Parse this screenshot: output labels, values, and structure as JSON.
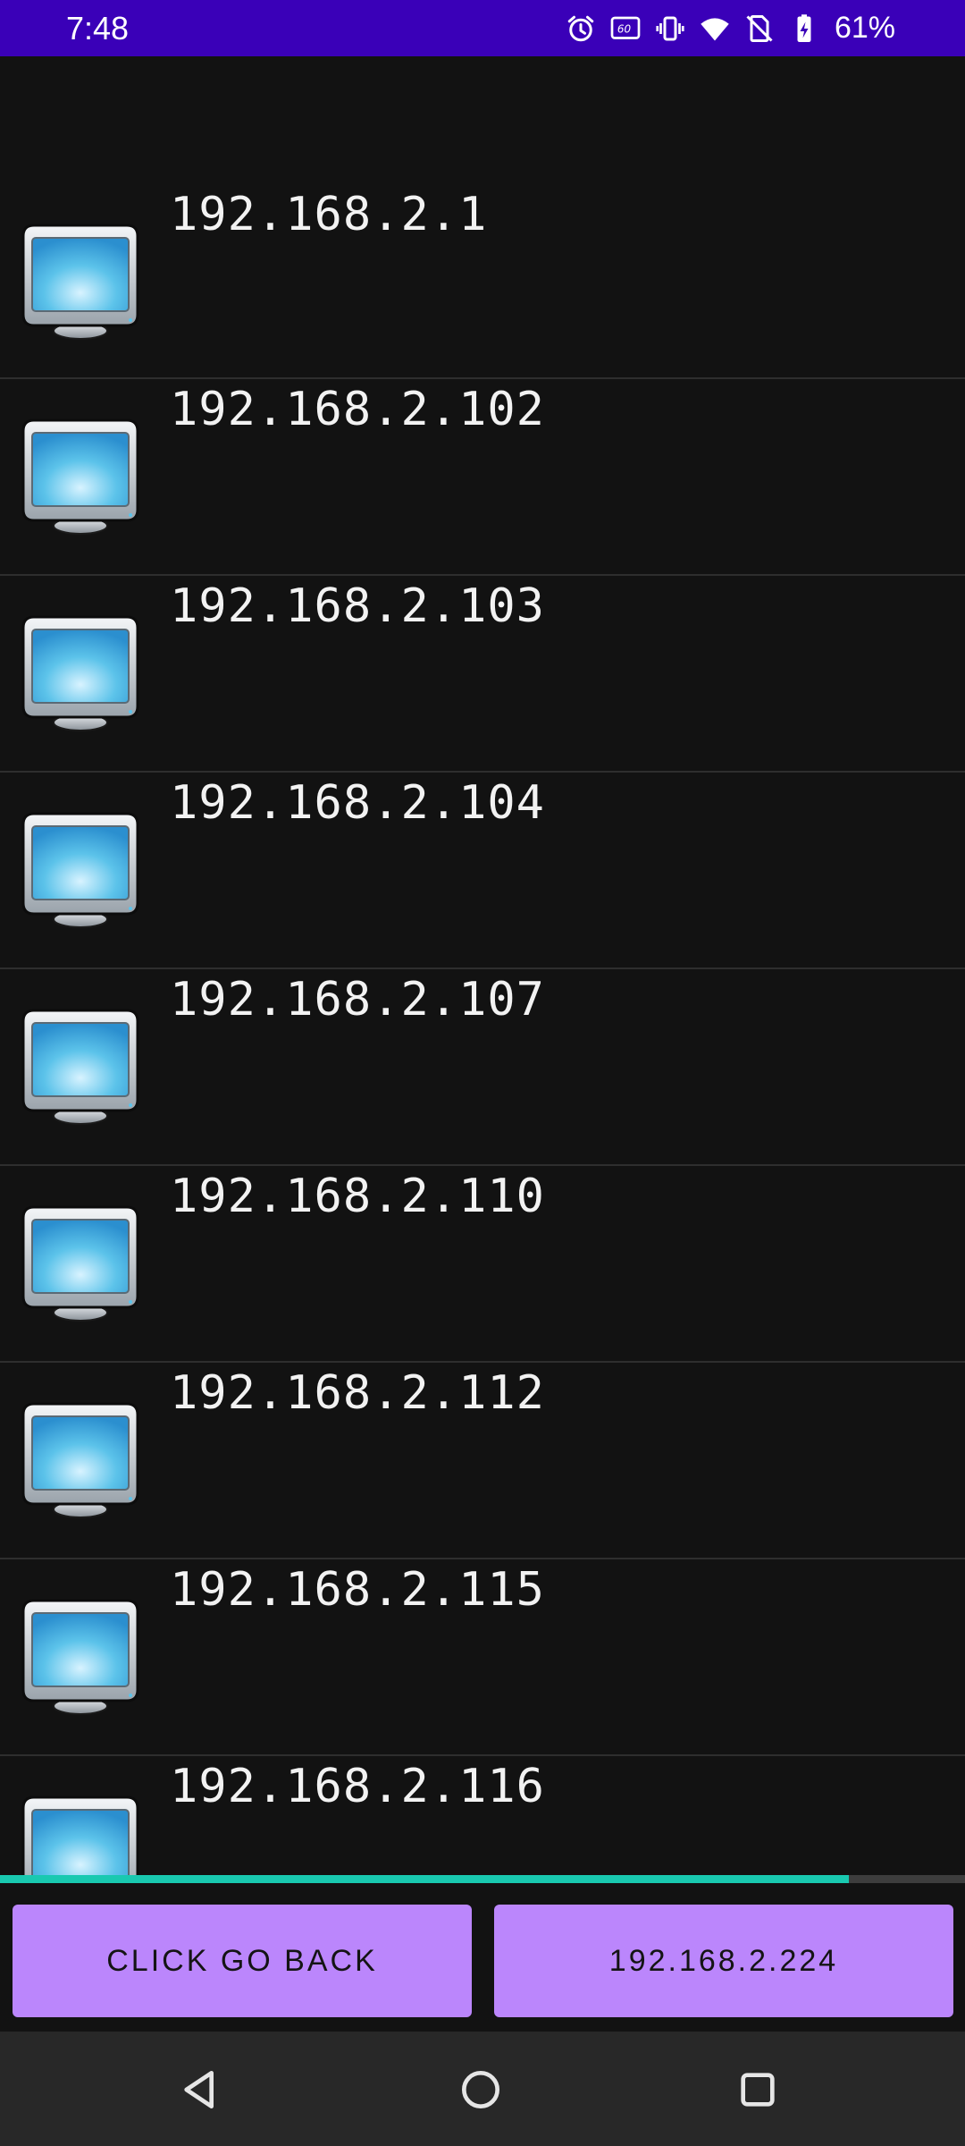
{
  "status_bar": {
    "time": "7:48",
    "battery_percent": "61%",
    "icons": [
      "alarm-icon",
      "refresh-rate-icon",
      "vibrate-icon",
      "wifi-icon",
      "no-sim-icon",
      "battery-charging-icon"
    ],
    "refresh_rate_label": "60",
    "bg_color": "#3a00b8"
  },
  "devices": [
    {
      "ip": "192.168.2.1",
      "icon": "monitor-icon"
    },
    {
      "ip": "192.168.2.102",
      "icon": "monitor-icon"
    },
    {
      "ip": "192.168.2.103",
      "icon": "monitor-icon"
    },
    {
      "ip": "192.168.2.104",
      "icon": "monitor-icon"
    },
    {
      "ip": "192.168.2.107",
      "icon": "monitor-icon"
    },
    {
      "ip": "192.168.2.110",
      "icon": "monitor-icon"
    },
    {
      "ip": "192.168.2.112",
      "icon": "monitor-icon"
    },
    {
      "ip": "192.168.2.115",
      "icon": "monitor-icon"
    },
    {
      "ip": "192.168.2.116",
      "icon": "monitor-icon"
    }
  ],
  "scan_progress": 0.88,
  "buttons": {
    "go_back_label": "CLICK GO BACK",
    "host_ip_label": "192.168.2.224",
    "color": "#bb86fc"
  },
  "nav_bar": {
    "icons": [
      "back-icon",
      "home-icon",
      "recents-icon"
    ]
  },
  "colors": {
    "background": "#121212",
    "progress": "#19c9b0",
    "divider": "#2e2e2e"
  }
}
